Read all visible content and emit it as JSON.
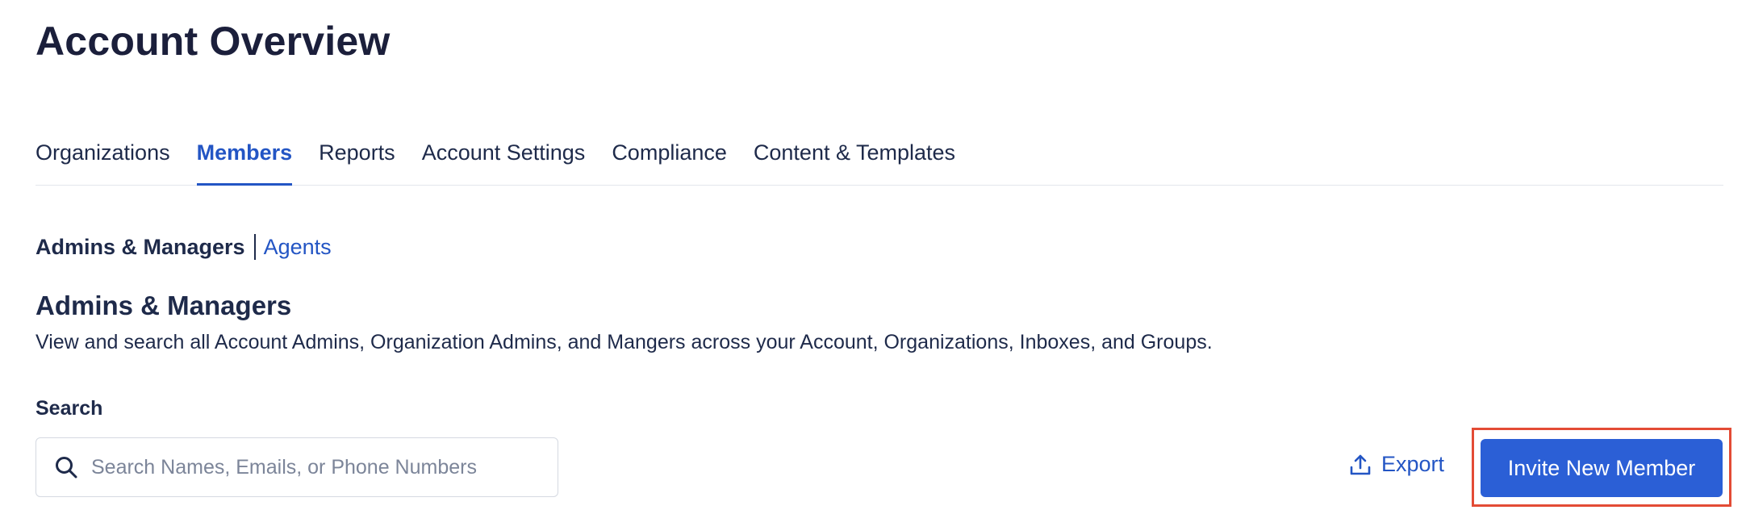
{
  "page": {
    "title": "Account Overview"
  },
  "tabs": [
    {
      "label": "Organizations",
      "active": false
    },
    {
      "label": "Members",
      "active": true
    },
    {
      "label": "Reports",
      "active": false
    },
    {
      "label": "Account Settings",
      "active": false
    },
    {
      "label": "Compliance",
      "active": false
    },
    {
      "label": "Content & Templates",
      "active": false
    }
  ],
  "subnav": {
    "active_label": "Admins & Managers",
    "link_label": "Agents"
  },
  "section": {
    "title": "Admins & Managers",
    "description": "View and search all Account Admins, Organization Admins, and Mangers across your Account, Organizations, Inboxes, and Groups."
  },
  "search": {
    "label": "Search",
    "placeholder": "Search Names, Emails, or Phone Numbers",
    "value": "",
    "icon": "search-icon"
  },
  "actions": {
    "export_label": "Export",
    "export_icon": "upload-icon",
    "invite_label": "Invite New Member"
  },
  "colors": {
    "accent": "#2355c4",
    "primary_button": "#2b5fd6",
    "highlight_outline": "#e34b35",
    "text": "#1e2a4a"
  }
}
